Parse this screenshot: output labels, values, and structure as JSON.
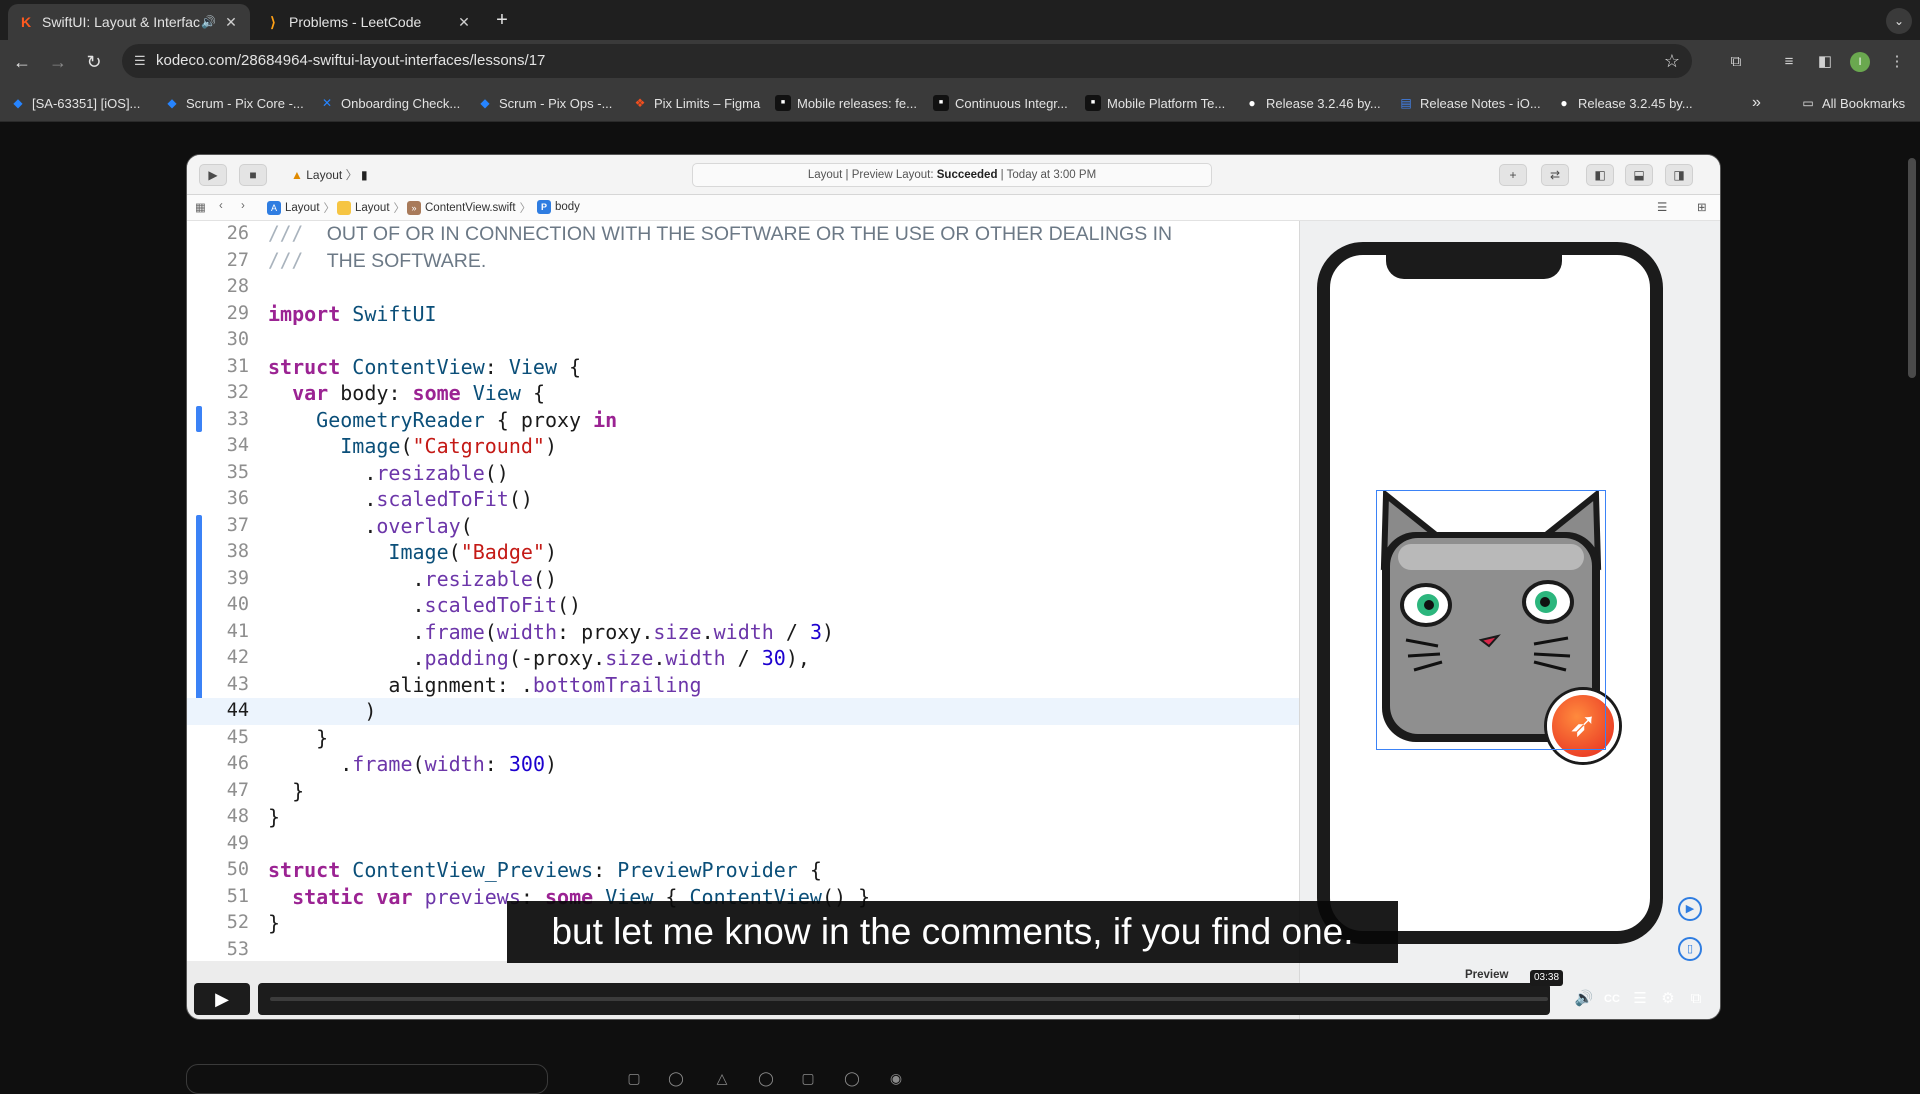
{
  "browser": {
    "tabs": [
      {
        "title": "SwiftUI: Layout & Interfac",
        "favicon": "K",
        "active": true
      },
      {
        "title": "Problems - LeetCode",
        "favicon": "leetcode-icon",
        "active": false
      }
    ],
    "new_tab": "+",
    "url": "kodeco.com/28684964-swiftui-layout-interfaces/lessons/17",
    "bookmarks": [
      {
        "label": "[SA-63351] [iOS]...",
        "icon": "jira"
      },
      {
        "label": "Scrum - Pix Core -...",
        "icon": "jira"
      },
      {
        "label": "Onboarding Check...",
        "icon": "jira"
      },
      {
        "label": "Scrum - Pix Ops -...",
        "icon": "jira"
      },
      {
        "label": "Pix Limits – Figma",
        "icon": "figma"
      },
      {
        "label": "Mobile releases: fe...",
        "icon": "dark"
      },
      {
        "label": "Continuous Integr...",
        "icon": "dark"
      },
      {
        "label": "Mobile Platform Te...",
        "icon": "dark"
      },
      {
        "label": "Release 3.2.46 by...",
        "icon": "github"
      },
      {
        "label": "Release Notes - iO...",
        "icon": "doc"
      },
      {
        "label": "Release 3.2.45 by...",
        "icon": "github"
      }
    ],
    "more_bookmarks": "»",
    "all_bookmarks": "All Bookmarks",
    "profile_initial": "I"
  },
  "xcode": {
    "scheme": "Layout",
    "status_prefix": "Layout | Preview Layout: ",
    "status_result": "Succeeded",
    "status_suffix": " | Today at 3:00 PM",
    "breadcrumbs": [
      "Layout",
      "Layout",
      "ContentView.swift",
      "body"
    ],
    "current_line": 44,
    "preview_label": "Preview"
  },
  "code_lines": [
    {
      "n": "26",
      "comment": "OUT OF OR IN CONNECTION WITH THE SOFTWARE OR THE USE OR OTHER DEALINGS IN"
    },
    {
      "n": "27",
      "comment": "THE SOFTWARE."
    },
    {
      "n": "28",
      "text": ""
    },
    {
      "n": "29",
      "text": "import SwiftUI"
    },
    {
      "n": "30",
      "text": ""
    },
    {
      "n": "31",
      "text": "struct ContentView: View {"
    },
    {
      "n": "32",
      "text": "  var body: some View {"
    },
    {
      "n": "33",
      "text": "    GeometryReader { proxy in"
    },
    {
      "n": "34",
      "text": "      Image(\"Catground\")"
    },
    {
      "n": "35",
      "text": "        .resizable()"
    },
    {
      "n": "36",
      "text": "        .scaledToFit()"
    },
    {
      "n": "37",
      "text": "        .overlay("
    },
    {
      "n": "38",
      "text": "          Image(\"Badge\")"
    },
    {
      "n": "39",
      "text": "            .resizable()"
    },
    {
      "n": "40",
      "text": "            .scaledToFit()"
    },
    {
      "n": "41",
      "text": "            .frame(width: proxy.size.width / 3)"
    },
    {
      "n": "42",
      "text": "            .padding(-proxy.size.width / 30),"
    },
    {
      "n": "43",
      "text": "          alignment: .bottomTrailing"
    },
    {
      "n": "44",
      "text": "        )"
    },
    {
      "n": "45",
      "text": "    }"
    },
    {
      "n": "46",
      "text": "      .frame(width: 300)"
    },
    {
      "n": "47",
      "text": "  }"
    },
    {
      "n": "48",
      "text": "}"
    },
    {
      "n": "49",
      "text": ""
    },
    {
      "n": "50",
      "text": "struct ContentView_Previews: PreviewProvider {"
    },
    {
      "n": "51",
      "text": "  static var previews: some View { ContentView() }"
    },
    {
      "n": "52",
      "text": "}"
    },
    {
      "n": "53",
      "text": ""
    }
  ],
  "video": {
    "caption": "but let me know in the comments, if you find one.",
    "timestamp": "03:38",
    "progress": 0.0,
    "colors": {
      "progress": "#2f9e6e",
      "accent": "#3b82f6"
    }
  }
}
